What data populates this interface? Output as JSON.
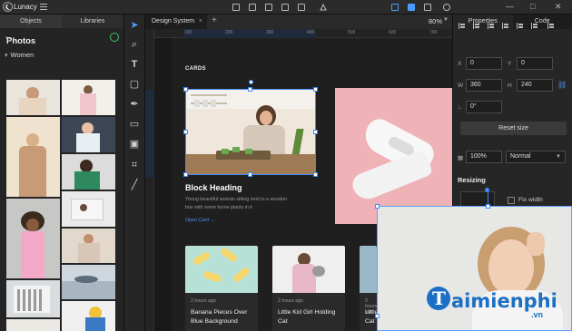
{
  "app": {
    "name": "Lunacy",
    "zoom": "80%"
  },
  "colors": {
    "accent": "#3e8bff",
    "panel": "#262626",
    "canvas": "#191919",
    "brand": "#1b6fc4"
  },
  "left_panel": {
    "tabs": [
      "Objects",
      "Libraries"
    ],
    "section_title": "Photos",
    "category": "Women"
  },
  "tools": [
    "pointer-icon",
    "zoom-icon",
    "text-icon",
    "rectangle-icon",
    "pen-icon",
    "video-icon",
    "image-icon",
    "crop-icon",
    "knife-icon"
  ],
  "document": {
    "tab_title": "Design System",
    "close": "×",
    "add": "+"
  },
  "ruler": {
    "marks": [
      "100",
      "200",
      "300",
      "400",
      "500",
      "600",
      "700"
    ]
  },
  "canvas": {
    "section_label": "CARDS",
    "block_heading": "Block Heading",
    "block_body": "Young beautiful woman sitting next to a wooden box with some home plants in it",
    "link": "Open Card →",
    "cards": [
      {
        "time": "2 hours ago",
        "title": "Banana Pieces Over Blue Background"
      },
      {
        "time": "2 hours ago",
        "title": "Little Kid Girl Holding Cat"
      },
      {
        "time": "2 hours ago",
        "title": "Little Kid Girl Holding Cat"
      }
    ]
  },
  "right_panel": {
    "tabs": [
      "Properties",
      "Code"
    ],
    "x_label": "X",
    "x_value": "0",
    "y_label": "Y",
    "y_value": "0",
    "w_label": "W",
    "w_value": "360",
    "h_label": "H",
    "h_value": "240",
    "rotation_value": "0°",
    "reset_label": "Reset size",
    "opacity_value": "100%",
    "blend_value": "Normal",
    "resizing_title": "Resizing",
    "fix_width_label": "Fix width"
  },
  "watermark": {
    "brand": "aimienphi",
    "sub": ".vn"
  }
}
